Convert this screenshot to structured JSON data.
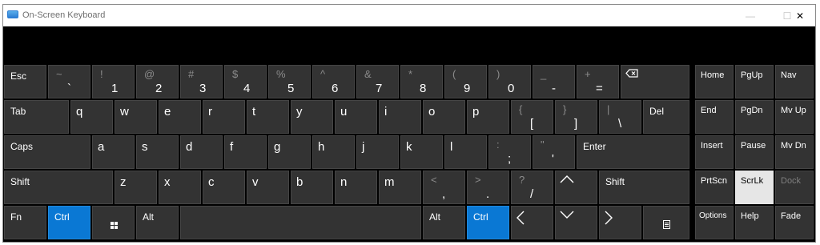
{
  "window": {
    "title": "On-Screen Keyboard",
    "controls": {
      "minimize": "—",
      "maximize": "☐",
      "close": "✕"
    }
  },
  "colors": {
    "background": "#000000",
    "key": "#333333",
    "active_key": "#0a78d4",
    "toggled_key": "#e6e6e6"
  },
  "rows": {
    "row1": {
      "esc": "Esc",
      "k1": {
        "shift": "~",
        "main": "`"
      },
      "k2": {
        "shift": "!",
        "main": "1"
      },
      "k3": {
        "shift": "@",
        "main": "2"
      },
      "k4": {
        "shift": "#",
        "main": "3"
      },
      "k5": {
        "shift": "$",
        "main": "4"
      },
      "k6": {
        "shift": "%",
        "main": "5"
      },
      "k7": {
        "shift": "^",
        "main": "6"
      },
      "k8": {
        "shift": "&",
        "main": "7"
      },
      "k9": {
        "shift": "*",
        "main": "8"
      },
      "k10": {
        "shift": "(",
        "main": "9"
      },
      "k11": {
        "shift": ")",
        "main": "0"
      },
      "k12": {
        "shift": "_",
        "main": "-"
      },
      "k13": {
        "shift": "+",
        "main": "="
      },
      "backspace_icon": "backspace-icon"
    },
    "row2": {
      "tab": "Tab",
      "q": "q",
      "w": "w",
      "e": "e",
      "r": "r",
      "t": "t",
      "y": "y",
      "u": "u",
      "i": "i",
      "o": "o",
      "p": "p",
      "lbrace": {
        "shift": "{",
        "main": "["
      },
      "rbrace": {
        "shift": "}",
        "main": "]"
      },
      "pipe": {
        "shift": "|",
        "main": "\\"
      },
      "del": "Del"
    },
    "row3": {
      "caps": "Caps",
      "a": "a",
      "s": "s",
      "d": "d",
      "f": "f",
      "g": "g",
      "h": "h",
      "j": "j",
      "k": "k",
      "l": "l",
      "semicolon": {
        "shift": ":",
        "main": ";"
      },
      "quote": {
        "shift": "\"",
        "main": "'"
      },
      "enter": "Enter"
    },
    "row4": {
      "shift_left": "Shift",
      "z": "z",
      "x": "x",
      "c": "c",
      "v": "v",
      "b": "b",
      "n": "n",
      "m": "m",
      "comma": {
        "shift": "<",
        "main": ","
      },
      "period": {
        "shift": ">",
        "main": "."
      },
      "slash": {
        "shift": "?",
        "main": "/"
      },
      "up_icon": "up-arrow-icon",
      "shift_right": "Shift"
    },
    "row5": {
      "fn": "Fn",
      "ctrl_left": "Ctrl",
      "win_icon": "windows-icon",
      "alt_left": "Alt",
      "space": "",
      "alt_right": "Alt",
      "ctrl_right": "Ctrl",
      "left_icon": "left-arrow-icon",
      "down_icon": "down-arrow-icon",
      "right_icon": "right-arrow-icon",
      "menu_icon": "context-menu-icon"
    }
  },
  "nav_keys": {
    "home": "Home",
    "pgup": "PgUp",
    "nav": "Nav",
    "end": "End",
    "pgdn": "PgDn",
    "mvup": "Mv Up",
    "insert": "Insert",
    "pause": "Pause",
    "mvdn": "Mv Dn",
    "prtscn": "PrtScn",
    "scrlk": "ScrLk",
    "dock": "Dock",
    "options": "Options",
    "help": "Help",
    "fade": "Fade"
  }
}
